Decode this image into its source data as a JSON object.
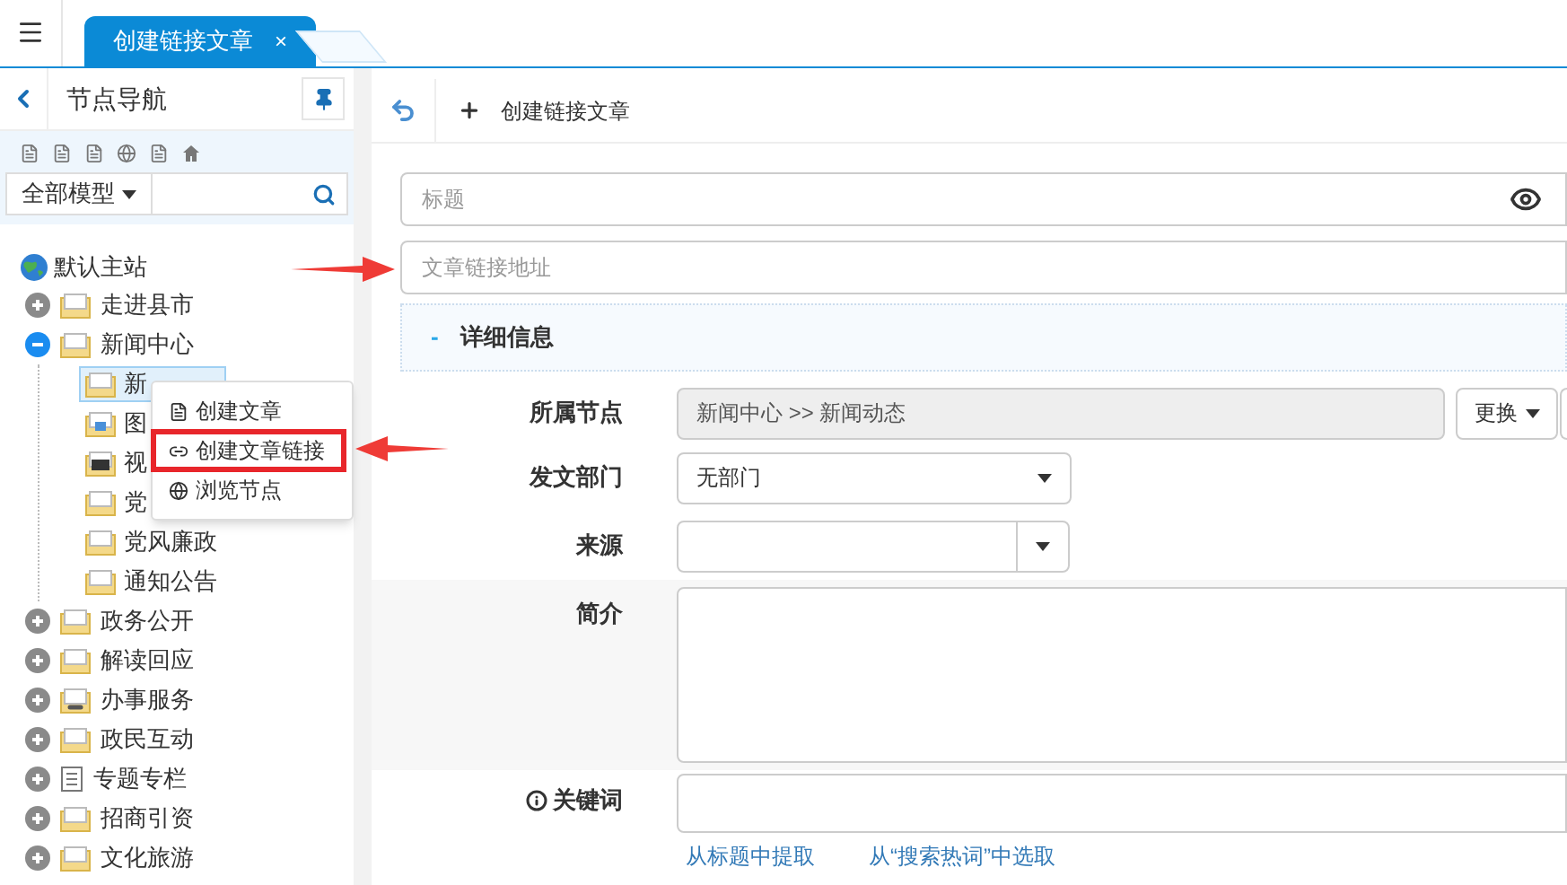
{
  "tabs": [
    {
      "label": "创建链接文章",
      "selected": true,
      "close": "×"
    }
  ],
  "sidebar": {
    "title": "节点导航",
    "model_select": "全部模型",
    "tree": [
      {
        "label": "默认主站",
        "kind": "globe",
        "children": [
          {
            "label": "走进县市",
            "kind": "folder",
            "expanded": false
          },
          {
            "label": "新闻中心",
            "kind": "folder",
            "expanded": true,
            "children": [
              {
                "label": "新",
                "kind": "folder",
                "selected": true
              },
              {
                "label": "图",
                "kind": "gallery",
                "selected": false
              },
              {
                "label": "视",
                "kind": "video",
                "selected": false
              },
              {
                "label": "党",
                "kind": "folder",
                "selected": false
              },
              {
                "label": "党风廉政",
                "kind": "folder",
                "selected": false
              },
              {
                "label": "通知公告",
                "kind": "folder",
                "selected": false
              }
            ]
          },
          {
            "label": "政务公开",
            "kind": "folder",
            "expanded": false
          },
          {
            "label": "解读回应",
            "kind": "folder",
            "expanded": false
          },
          {
            "label": "办事服务",
            "kind": "linkfolder",
            "expanded": false
          },
          {
            "label": "政民互动",
            "kind": "folder",
            "expanded": false
          },
          {
            "label": "专题专栏",
            "kind": "page",
            "expanded": false
          },
          {
            "label": "招商引资",
            "kind": "folder",
            "expanded": false
          },
          {
            "label": "文化旅游",
            "kind": "folder",
            "expanded": false
          }
        ]
      }
    ]
  },
  "context_menu": [
    {
      "label": "创建文章",
      "kind": "page",
      "highlighted": false
    },
    {
      "label": "创建文章链接",
      "kind": "link",
      "highlighted": true
    },
    {
      "label": "浏览节点",
      "kind": "globe",
      "highlighted": false
    }
  ],
  "toolbar": {
    "title": "创建链接文章"
  },
  "title_field": {
    "placeholder": "标题"
  },
  "url_field": {
    "placeholder": "文章链接地址"
  },
  "section": {
    "toggle": "-",
    "title": "详细信息"
  },
  "form": [
    {
      "kind": "readonly",
      "label": "所属节点",
      "value": "新闻中心 >> 新闻动态",
      "button": "更换"
    },
    {
      "kind": "select",
      "label": "发文部门",
      "value": "无部门"
    },
    {
      "kind": "combo",
      "label": "来源"
    },
    {
      "kind": "textarea",
      "label": "简介"
    },
    {
      "kind": "keywords",
      "label": "关键词",
      "links": [
        "从标题中提取",
        "从“搜索热词”中选取"
      ]
    }
  ]
}
